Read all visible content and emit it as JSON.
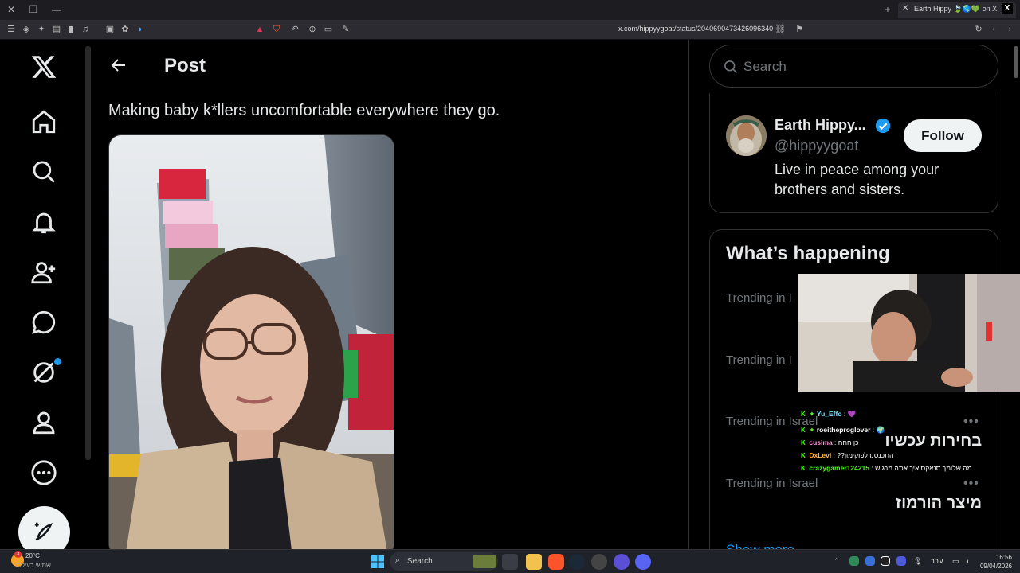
{
  "browser": {
    "tab_title": "Earth Hippy 🍃🌎💚 on X: \"",
    "url": "x.com/hippyygoat/status/2040690473426096340"
  },
  "post": {
    "header_title": "Post",
    "text": "Making baby k*llers uncomfortable everywhere they go."
  },
  "sidebar": {
    "search_placeholder": "Search",
    "profile": {
      "name": "Earth Hippy...",
      "handle": "@hippyygoat",
      "follow_label": "Follow",
      "bio": "Live in peace among your brothers and sisters."
    },
    "happening": {
      "title": "What’s happening",
      "trends": [
        {
          "label": "Trending in I",
          "name": ""
        },
        {
          "label": "Trending in I",
          "name": ""
        },
        {
          "label": "Trending in Israel",
          "name": "בחירות עכשיו"
        },
        {
          "label": "Trending in Israel",
          "name": "מיצר הורמוז"
        }
      ],
      "show_more": "Show more"
    }
  },
  "stream_chat": [
    {
      "user": "Yu_Effo",
      "color": "#7fe3ff",
      "message": "💜"
    },
    {
      "user": "roeitheproglover",
      "color": "#ffffff",
      "message": "🌍"
    },
    {
      "user": "cusima",
      "color": "#ff9ad5",
      "message": "כן חחח"
    },
    {
      "user": "DxLevi",
      "color": "#ffb43c",
      "message": "??התכנסנו לפוקימון"
    },
    {
      "user": "crazygamer124215",
      "color": "#53fc18",
      "message": "מה שלומך סנאקס איך אתה מרגיש"
    }
  ],
  "taskbar": {
    "weather_temp": "20°C",
    "weather_desc": "שמשי בעיקרו",
    "search_label": "Search",
    "lang": "עבר",
    "time": "16:56",
    "date": "09/04/2026",
    "weather_badge": "3"
  },
  "colors": {
    "accent": "#1d9bf0",
    "background": "#000000",
    "border": "#2f3336",
    "kick_green": "#53fc18"
  }
}
